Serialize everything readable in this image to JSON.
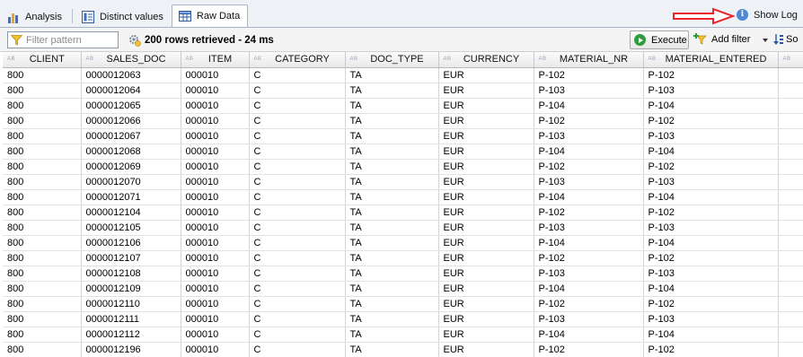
{
  "tabs": [
    {
      "label": "Analysis",
      "icon": "bar-chart-icon",
      "active": false
    },
    {
      "label": "Distinct values",
      "icon": "distinct-values-icon",
      "active": false
    },
    {
      "label": "Raw Data",
      "icon": "table-grid-icon",
      "active": true
    }
  ],
  "show_log": {
    "label": "Show Log",
    "icon": "info-icon"
  },
  "annotation": {
    "arrow_color": "#e8262b",
    "icon": "red-arrow-icon"
  },
  "toolbar": {
    "filter_placeholder": "Filter pattern",
    "row_info": "200 rows retrieved - 24 ms",
    "execute_label": "Execute",
    "add_filter_label": "Add filter",
    "sort_label": "So"
  },
  "colors": {
    "execute_icon": "#2f9d3d",
    "info_icon": "#4f86d6"
  },
  "table": {
    "type_badge": "AB",
    "columns": [
      "CLIENT",
      "SALES_DOC",
      "ITEM",
      "CATEGORY",
      "DOC_TYPE",
      "CURRENCY",
      "MATERIAL_NR",
      "MATERIAL_ENTERED"
    ],
    "rows": [
      [
        "800",
        "0000012063",
        "000010",
        "C",
        "TA",
        "EUR",
        "P-102",
        "P-102"
      ],
      [
        "800",
        "0000012064",
        "000010",
        "C",
        "TA",
        "EUR",
        "P-103",
        "P-103"
      ],
      [
        "800",
        "0000012065",
        "000010",
        "C",
        "TA",
        "EUR",
        "P-104",
        "P-104"
      ],
      [
        "800",
        "0000012066",
        "000010",
        "C",
        "TA",
        "EUR",
        "P-102",
        "P-102"
      ],
      [
        "800",
        "0000012067",
        "000010",
        "C",
        "TA",
        "EUR",
        "P-103",
        "P-103"
      ],
      [
        "800",
        "0000012068",
        "000010",
        "C",
        "TA",
        "EUR",
        "P-104",
        "P-104"
      ],
      [
        "800",
        "0000012069",
        "000010",
        "C",
        "TA",
        "EUR",
        "P-102",
        "P-102"
      ],
      [
        "800",
        "0000012070",
        "000010",
        "C",
        "TA",
        "EUR",
        "P-103",
        "P-103"
      ],
      [
        "800",
        "0000012071",
        "000010",
        "C",
        "TA",
        "EUR",
        "P-104",
        "P-104"
      ],
      [
        "800",
        "0000012104",
        "000010",
        "C",
        "TA",
        "EUR",
        "P-102",
        "P-102"
      ],
      [
        "800",
        "0000012105",
        "000010",
        "C",
        "TA",
        "EUR",
        "P-103",
        "P-103"
      ],
      [
        "800",
        "0000012106",
        "000010",
        "C",
        "TA",
        "EUR",
        "P-104",
        "P-104"
      ],
      [
        "800",
        "0000012107",
        "000010",
        "C",
        "TA",
        "EUR",
        "P-102",
        "P-102"
      ],
      [
        "800",
        "0000012108",
        "000010",
        "C",
        "TA",
        "EUR",
        "P-103",
        "P-103"
      ],
      [
        "800",
        "0000012109",
        "000010",
        "C",
        "TA",
        "EUR",
        "P-104",
        "P-104"
      ],
      [
        "800",
        "0000012110",
        "000010",
        "C",
        "TA",
        "EUR",
        "P-102",
        "P-102"
      ],
      [
        "800",
        "0000012111",
        "000010",
        "C",
        "TA",
        "EUR",
        "P-103",
        "P-103"
      ],
      [
        "800",
        "0000012112",
        "000010",
        "C",
        "TA",
        "EUR",
        "P-104",
        "P-104"
      ],
      [
        "800",
        "0000012196",
        "000010",
        "C",
        "TA",
        "EUR",
        "P-102",
        "P-102"
      ]
    ]
  }
}
